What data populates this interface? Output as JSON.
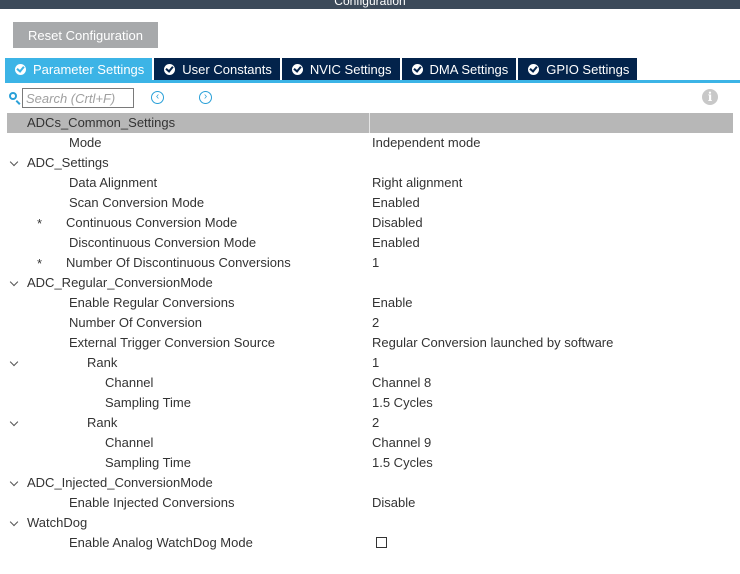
{
  "window": {
    "title": "Configuration"
  },
  "reset_button": "Reset Configuration",
  "tabs": [
    {
      "label": "Parameter Settings",
      "active": true
    },
    {
      "label": "User Constants",
      "active": false
    },
    {
      "label": "NVIC Settings",
      "active": false
    },
    {
      "label": "DMA Settings",
      "active": false
    },
    {
      "label": "GPIO Settings",
      "active": false
    }
  ],
  "search": {
    "placeholder": "Search (Crtl+F)",
    "value": ""
  },
  "nav": {
    "prev_icon": "chevron-left-circle-icon",
    "next_icon": "chevron-right-circle-icon",
    "info_icon": "info-icon"
  },
  "colors": {
    "active_tab": "#3cb4e6",
    "tab": "#03234b",
    "group_header": "#b7b7b7"
  },
  "groups": {
    "adcs_common": {
      "title": "ADCs_Common_Settings",
      "mode": {
        "name": "Mode",
        "value": "Independent mode"
      }
    },
    "adc_settings": {
      "title": "ADC_Settings",
      "data_alignment": {
        "name": "Data Alignment",
        "value": "Right alignment"
      },
      "scan_mode": {
        "name": "Scan Conversion Mode",
        "value": "Enabled"
      },
      "continuous_mode": {
        "name": "Continuous Conversion Mode",
        "value": "Disabled",
        "marker": "*"
      },
      "discontinuous_mode": {
        "name": "Discontinuous Conversion Mode",
        "value": "Enabled"
      },
      "num_discontinuous": {
        "name": "Number Of Discontinuous Conversions",
        "value": "1",
        "marker": "*"
      }
    },
    "regular": {
      "title": "ADC_Regular_ConversionMode",
      "enable": {
        "name": "Enable Regular Conversions",
        "value": "Enable"
      },
      "number": {
        "name": "Number Of Conversion",
        "value": "2"
      },
      "trigger": {
        "name": "External Trigger Conversion Source",
        "value": "Regular Conversion launched by software"
      },
      "ranks": [
        {
          "name": "Rank",
          "value": "1",
          "channel_name": "Channel",
          "channel": "Channel 8",
          "sampling_name": "Sampling Time",
          "sampling": "1.5 Cycles"
        },
        {
          "name": "Rank",
          "value": "2",
          "channel_name": "Channel",
          "channel": "Channel 9",
          "sampling_name": "Sampling Time",
          "sampling": "1.5 Cycles"
        }
      ]
    },
    "injected": {
      "title": "ADC_Injected_ConversionMode",
      "enable": {
        "name": "Enable Injected Conversions",
        "value": "Disable"
      }
    },
    "watchdog": {
      "title": "WatchDog",
      "enable": {
        "name": "Enable Analog WatchDog Mode",
        "checked": false
      }
    }
  }
}
